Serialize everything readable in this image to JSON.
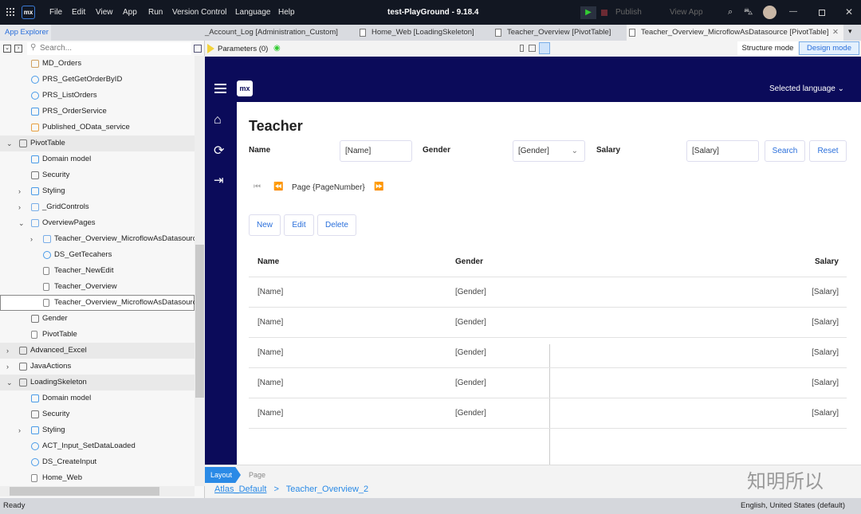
{
  "window": {
    "title": "test-PlayGround  -  9.18.4",
    "menu": [
      "File",
      "Edit",
      "View",
      "App",
      "Run",
      "Version Control",
      "Language",
      "Help"
    ],
    "publish": "Publish",
    "view_app": "View App"
  },
  "tabs": [
    {
      "label": "_Account_Log [Administration_Custom]",
      "active": false
    },
    {
      "label": "Home_Web [LoadingSkeleton]",
      "active": false
    },
    {
      "label": "Teacher_Overview [PivotTable]",
      "active": false
    },
    {
      "label": "Teacher_Overview_MicroflowAsDatasource [PivotTable]",
      "active": true
    }
  ],
  "explorer": {
    "title": "App Explorer",
    "search_placeholder": "Search...",
    "items": [
      {
        "label": "MD_Orders",
        "level": 1,
        "icon": "mapping-icon"
      },
      {
        "label": "PRS_GetGetOrderByID",
        "level": 1,
        "icon": "microflow-icon"
      },
      {
        "label": "PRS_ListOrders",
        "level": 1,
        "icon": "microflow-icon"
      },
      {
        "label": "PRS_OrderService",
        "level": 1,
        "icon": "rest-service-icon"
      },
      {
        "label": "Published_OData_service",
        "level": 1,
        "icon": "odata-icon"
      },
      {
        "label": "PivotTable",
        "level": 0,
        "icon": "module-icon",
        "expanded": true,
        "highlight": true
      },
      {
        "label": "Domain model",
        "level": 1,
        "icon": "domain-model-icon"
      },
      {
        "label": "Security",
        "level": 1,
        "icon": "key-icon"
      },
      {
        "label": "Styling",
        "level": 1,
        "icon": "styling-icon",
        "collapsed": true
      },
      {
        "label": "_GridControls",
        "level": 1,
        "icon": "folder-icon",
        "collapsed": true
      },
      {
        "label": "OverviewPages",
        "level": 1,
        "icon": "folder-icon",
        "expanded": true
      },
      {
        "label": "Teacher_Overview_MicroflowAsDatasource",
        "level": 2,
        "icon": "folder-icon",
        "collapsed": true
      },
      {
        "label": "DS_GetTecahers",
        "level": 2,
        "icon": "microflow-icon"
      },
      {
        "label": "Teacher_NewEdit",
        "level": 2,
        "icon": "page-icon"
      },
      {
        "label": "Teacher_Overview",
        "level": 2,
        "icon": "page-icon"
      },
      {
        "label": "Teacher_Overview_MicroflowAsDatasource",
        "level": 2,
        "icon": "page-icon",
        "selected": true
      },
      {
        "label": "Gender",
        "level": 1,
        "icon": "enumeration-icon"
      },
      {
        "label": "PivotTable",
        "level": 1,
        "icon": "page-icon"
      },
      {
        "label": "Advanced_Excel",
        "level": 0,
        "icon": "module-icon",
        "collapsed": true,
        "highlight": true
      },
      {
        "label": "JavaActions",
        "level": 0,
        "icon": "module-icon",
        "collapsed": true
      },
      {
        "label": "LoadingSkeleton",
        "level": 0,
        "icon": "module-icon",
        "expanded": true,
        "highlight": true
      },
      {
        "label": "Domain model",
        "level": 1,
        "icon": "domain-model-icon"
      },
      {
        "label": "Security",
        "level": 1,
        "icon": "key-icon"
      },
      {
        "label": "Styling",
        "level": 1,
        "icon": "styling-icon",
        "collapsed": true
      },
      {
        "label": "ACT_Input_SetDataLoaded",
        "level": 1,
        "icon": "microflow-icon"
      },
      {
        "label": "DS_CreateInput",
        "level": 1,
        "icon": "microflow-icon"
      },
      {
        "label": "Home_Web",
        "level": 1,
        "icon": "page-icon"
      }
    ]
  },
  "toolbar": {
    "parameters": "Parameters (0)",
    "structure_mode": "Structure mode",
    "design_mode": "Design mode"
  },
  "page": {
    "selected_language": "Selected language",
    "title": "Teacher",
    "filters": {
      "name_label": "Name",
      "name_value": "[Name]",
      "gender_label": "Gender",
      "gender_value": "[Gender]",
      "salary_label": "Salary",
      "salary_value": "[Salary]",
      "search": "Search",
      "reset": "Reset"
    },
    "pager": "Page {PageNumber}",
    "actions": {
      "new": "New",
      "edit": "Edit",
      "delete": "Delete"
    },
    "table": {
      "headers": [
        "Name",
        "Gender",
        "Salary"
      ],
      "rows": [
        [
          "[Name]",
          "[Gender]",
          "[Salary]"
        ],
        [
          "[Name]",
          "[Gender]",
          "[Salary]"
        ],
        [
          "[Name]",
          "[Gender]",
          "[Salary]"
        ],
        [
          "[Name]",
          "[Gender]",
          "[Salary]"
        ],
        [
          "[Name]",
          "[Gender]",
          "[Salary]"
        ]
      ]
    }
  },
  "bottom": {
    "layout": "Layout",
    "page": "Page",
    "crumb_layout": "Atlas_Default",
    "sep": ">",
    "crumb_page": "Teacher_Overview_2"
  },
  "status": {
    "left": "Ready",
    "right": "English, United States (default)"
  },
  "watermark": "知明所以",
  "colors": {
    "accent": "#2a6fdb",
    "navy": "#0b0b5a",
    "topbar": "#121722"
  }
}
